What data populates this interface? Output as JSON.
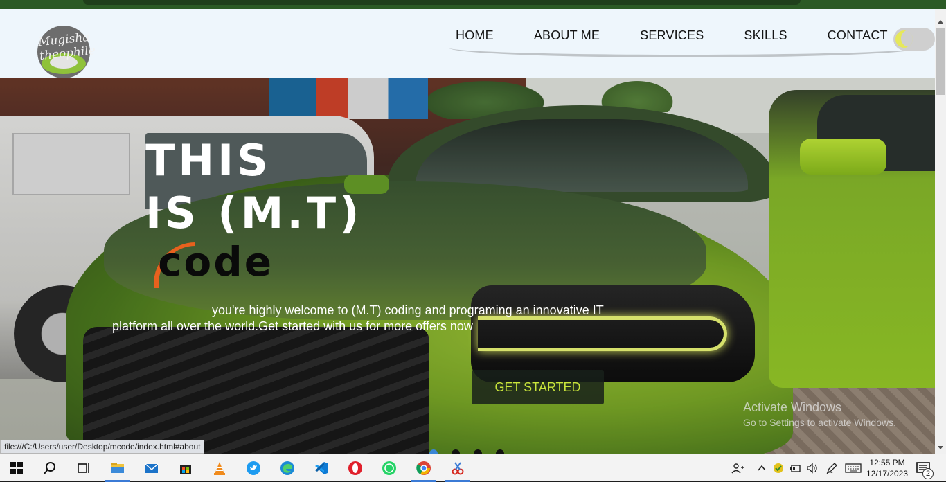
{
  "nav": {
    "logo_text": "Mugisha theophile",
    "links": [
      "HOME",
      "ABOUT ME",
      "SERVICES",
      "SKILLS",
      "CONTACT"
    ]
  },
  "hero": {
    "title_line1": "THIS",
    "title_line2": "IS (M.T)",
    "title_line3": "code",
    "subtitle_line1": "you're highly welcome to (M.T) coding and programing an innovative IT",
    "subtitle_line2": "platform all over the world.Get started with us for more offers now",
    "cta_label": "GET STARTED",
    "slide_count": 4,
    "active_slide": 1
  },
  "watermark": {
    "line1": "Activate Windows",
    "line2": "Go to Settings to activate Windows."
  },
  "status_url": "file:///C:/Users/user/Desktop/mcode/index.html#about",
  "taskbar": {
    "apps": [
      "start",
      "search",
      "task-view",
      "file-explorer",
      "mail",
      "store",
      "vlc",
      "twitter",
      "edge",
      "vscode",
      "opera",
      "whatsapp",
      "chrome",
      "snipping-tool"
    ],
    "time": "12:55 PM",
    "date": "12/17/2023",
    "notification_count": "2"
  },
  "colors": {
    "accent_green": "#c9e43b",
    "nav_bg": "#eef6fc",
    "taskbar_active": "#3b7bd6",
    "code_arc": "#e8611e"
  }
}
